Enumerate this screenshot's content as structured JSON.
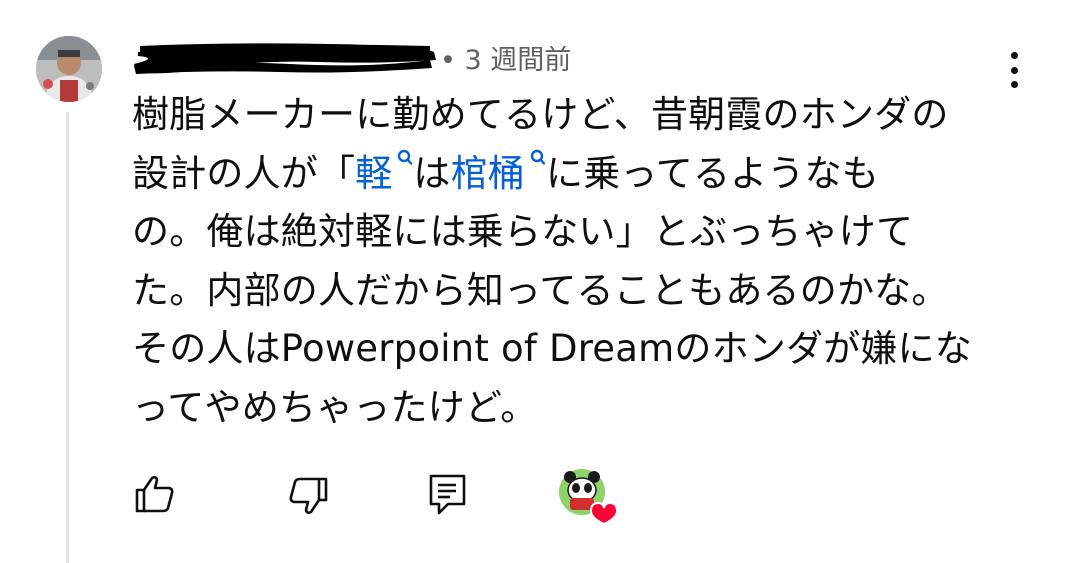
{
  "comment": {
    "timestamp": "3 週間前",
    "lines": [
      {
        "parts": [
          {
            "text": "樹脂メーカーに勤めてるけど、昔朝霞のホンダの",
            "link": false
          }
        ]
      },
      {
        "parts": [
          {
            "text": "設計の人が「",
            "link": false
          },
          {
            "text": "軽",
            "link": true
          },
          {
            "text": "は",
            "link": false
          },
          {
            "text": "棺桶",
            "link": true
          },
          {
            "text": "に乗ってるようなも",
            "link": false
          }
        ]
      },
      {
        "parts": [
          {
            "text": "の。俺は絶対軽には乗らない」とぶっちゃけて",
            "link": false
          }
        ]
      },
      {
        "parts": [
          {
            "text": "た。内部の人だから知ってることもあるのかな。",
            "link": false
          }
        ]
      },
      {
        "parts": [
          {
            "text": "その人はPowerpoint of Dreamのホンダが嫌にな",
            "link": false
          }
        ]
      },
      {
        "parts": [
          {
            "text": "ってやめちゃったけど。",
            "link": false
          }
        ]
      }
    ]
  },
  "icons": {
    "like": "thumb-up-icon",
    "dislike": "thumb-down-icon",
    "reply": "reply-icon",
    "menu": "more-vert-icon",
    "search": "search-icon",
    "creator_heart": "creator-heart-icon"
  },
  "colors": {
    "text": "#0f0f0f",
    "meta": "#606060",
    "link": "#065fd4",
    "heart": "#ff0033",
    "thread_line": "#e6e6e6"
  }
}
